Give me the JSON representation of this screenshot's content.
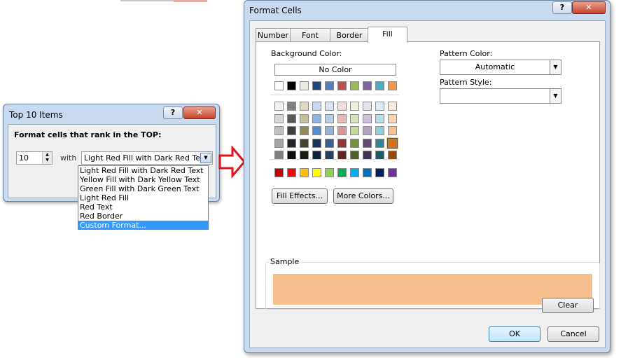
{
  "top10": {
    "title": "Top 10 Items",
    "help": "?",
    "close": "✕",
    "heading": "Format cells that rank in the TOP:",
    "rank_value": "10",
    "with_label": "with",
    "selected_format": "Light Red Fill with Dark Red Text",
    "options": [
      "Light Red Fill with Dark Red Text",
      "Yellow Fill with Dark Yellow Text",
      "Green Fill with Dark Green Text",
      "Light Red Fill",
      "Red Text",
      "Red Border",
      "Custom Format..."
    ],
    "highlighted_option_index": 6
  },
  "format_cells": {
    "title": "Format Cells",
    "help": "?",
    "close": "✕",
    "tabs": [
      "Number",
      "Font",
      "Border",
      "Fill"
    ],
    "active_tab": "Fill",
    "background_color_label": "Background Color:",
    "no_color_label": "No Color",
    "pattern_color_label": "Pattern Color:",
    "pattern_color_value": "Automatic",
    "pattern_style_label": "Pattern Style:",
    "pattern_style_value": "",
    "fill_effects_label": "Fill Effects...",
    "more_colors_label": "More Colors...",
    "sample_label": "Sample",
    "sample_color": "#f9c08f",
    "clear_label": "Clear",
    "ok_label": "OK",
    "cancel_label": "Cancel",
    "palette": {
      "theme_row": [
        "#ffffff",
        "#000000",
        "#eeece1",
        "#1f497d",
        "#4f81bd",
        "#c0504d",
        "#9bbb59",
        "#8064a2",
        "#4bacc6",
        "#f79646"
      ],
      "tint_rows": [
        [
          "#f2f2f2",
          "#7f7f7f",
          "#ddd9c3",
          "#c6d9f0",
          "#dbe5f1",
          "#f2dcdb",
          "#ebf1dd",
          "#e5e0ec",
          "#dbeef3",
          "#fdeada"
        ],
        [
          "#d8d8d8",
          "#595959",
          "#c4bd97",
          "#8db3e2",
          "#b8cce4",
          "#e5b9b7",
          "#d7e3bc",
          "#ccc1d9",
          "#b7dde8",
          "#fbd5b5"
        ],
        [
          "#bfbfbf",
          "#3f3f3f",
          "#938953",
          "#548dd4",
          "#95b3d7",
          "#d99694",
          "#c3d69b",
          "#b2a2c7",
          "#92cddc",
          "#fac08f"
        ],
        [
          "#a5a5a5",
          "#262626",
          "#494429",
          "#17365d",
          "#366092",
          "#953734",
          "#76923c",
          "#5f497a",
          "#31859b",
          "#e36c09"
        ],
        [
          "#7f7f7f",
          "#0c0c0c",
          "#1d1b10",
          "#0f243e",
          "#244061",
          "#632423",
          "#4f6128",
          "#3f3151",
          "#205867",
          "#974806"
        ]
      ],
      "standard_row": [
        "#c00000",
        "#ff0000",
        "#ffc000",
        "#ffff00",
        "#92d050",
        "#00b050",
        "#00b0f0",
        "#0070c0",
        "#002060",
        "#7030a0"
      ],
      "selected": {
        "row": 3,
        "col": 9
      }
    }
  }
}
